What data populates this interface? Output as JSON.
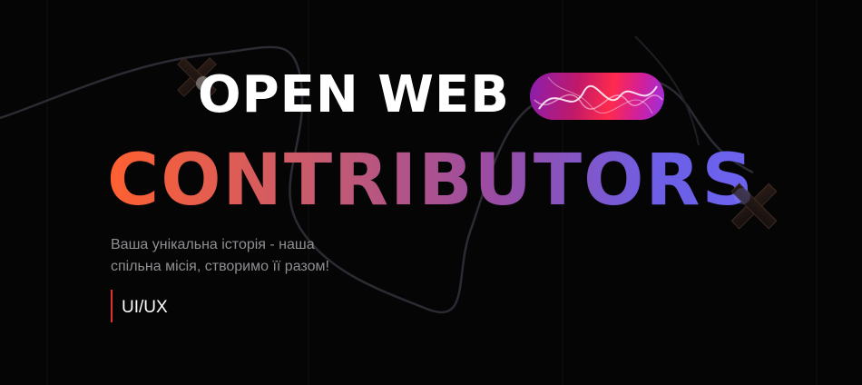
{
  "hero": {
    "title_line1": "OPEN WEB",
    "title_line2": "CONTRIBUTORS",
    "subtitle_line1": "Ваша унікальна історія - наша",
    "subtitle_line2": "спільна місія, створимо її разом!",
    "tag": "UI/UX"
  },
  "colors": {
    "background": "#050505",
    "gradient_start": "#ff6030",
    "gradient_end": "#6b63f0",
    "tag_accent": "#e0332b",
    "subtitle": "#8f8f93"
  },
  "icons": {
    "cross_1": "cross-icon",
    "cross_2": "cross-icon",
    "pill": "abstract-gradient-pill"
  }
}
